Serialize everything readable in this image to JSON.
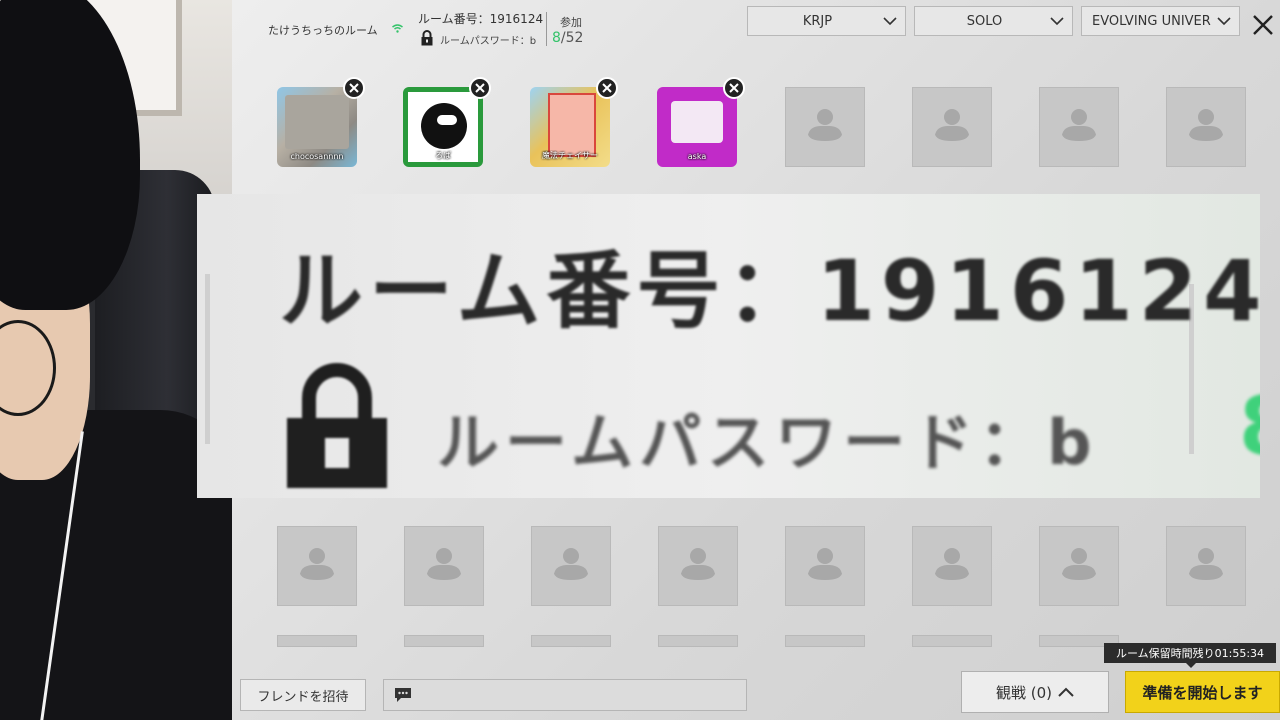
{
  "room": {
    "host_name": "たけうちっちのルーム",
    "room_number": "ルーム番号：1916124",
    "room_password": "ルームパスワード：b",
    "join_label": "参加",
    "join_current": "8",
    "join_total": "/52"
  },
  "filters": {
    "region": "KRJP",
    "mode": "SOLO",
    "map": "EVOLVING UNIVERS"
  },
  "players": [
    {
      "name": "chocosannnn"
    },
    {
      "name": "ろば"
    },
    {
      "name": "魔法チェイサー"
    },
    {
      "name": "aska"
    }
  ],
  "zoom": {
    "room_number": "ルーム番号：1916124",
    "room_password": "ルームパスワード：b"
  },
  "bottom": {
    "invite_label": "フレンドを招待",
    "spectate_label": "観戦 (0)",
    "ready_label": "準備を開始します",
    "timer_text": "ルーム保留時間残り01:55:34"
  },
  "colors": {
    "accent": "#f2d21a",
    "join_green": "#34c36a"
  }
}
